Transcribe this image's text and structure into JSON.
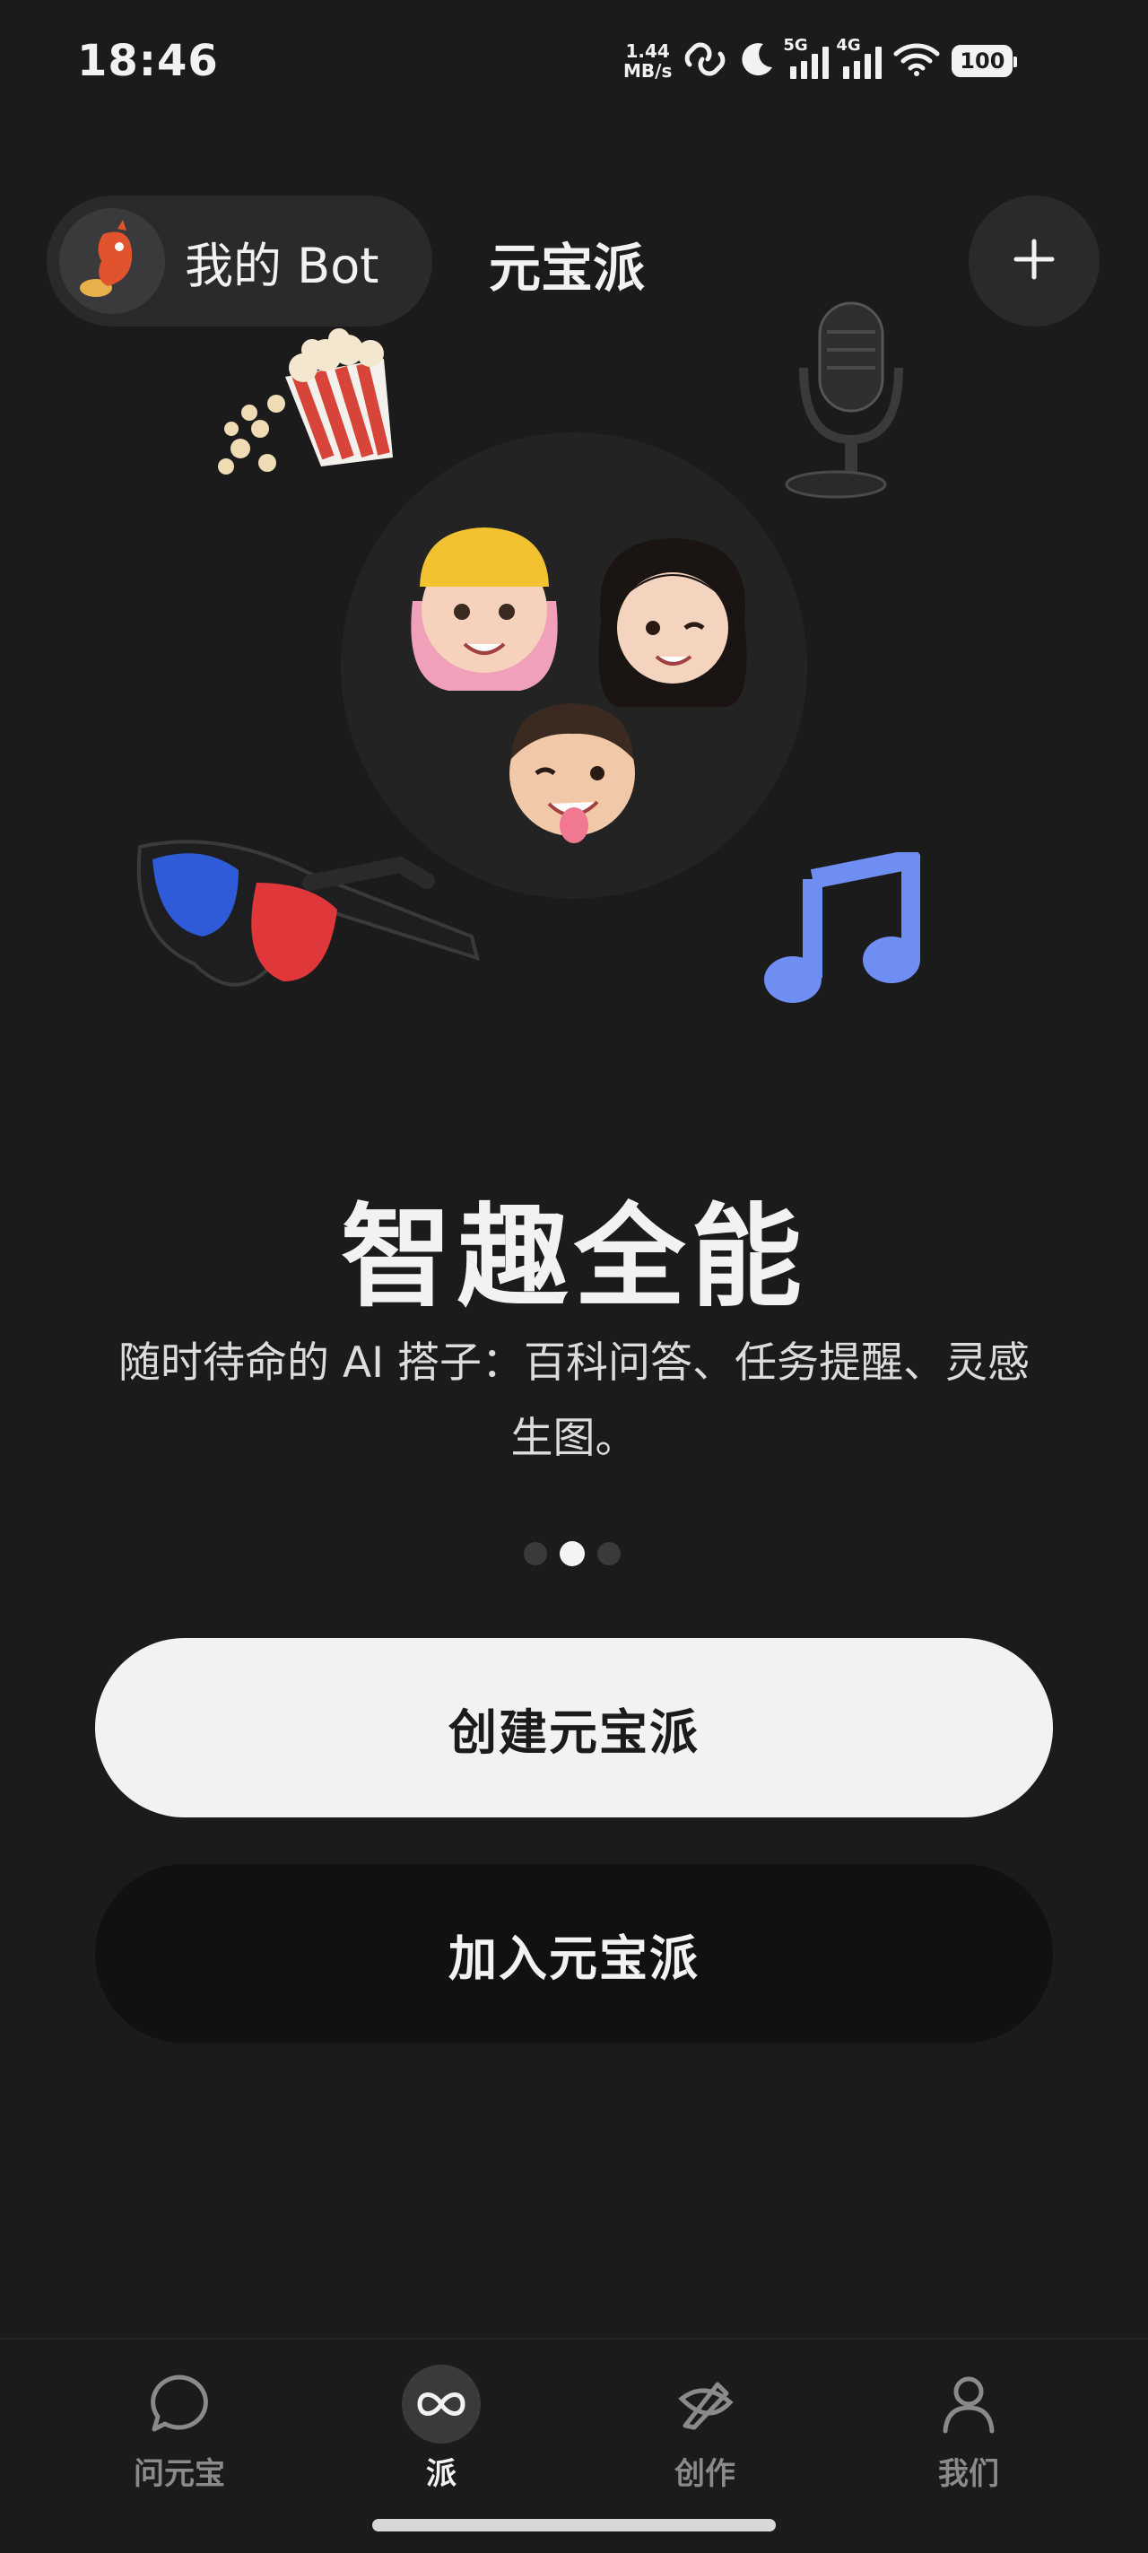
{
  "status_bar": {
    "time": "18:46",
    "net_speed_value": "1.44",
    "net_speed_unit": "MB/s",
    "signal1_label": "5G",
    "signal2_label": "4G",
    "battery": "100"
  },
  "top_nav": {
    "my_bot_label": "我的 Bot",
    "tab_label": "元宝派",
    "add_icon": "plus-icon"
  },
  "hero": {
    "title": "智趣全能",
    "description": "随时待命的 AI 搭子：百科问答、任务提醒、灵感生图。",
    "page_indicator": {
      "count": 3,
      "active_index": 1
    }
  },
  "actions": {
    "create_label": "创建元宝派",
    "join_label": "加入元宝派"
  },
  "bottom_nav": {
    "items": [
      {
        "label": "问元宝",
        "icon": "chat-bubble-icon",
        "active": false
      },
      {
        "label": "派",
        "icon": "infinity-icon",
        "active": true
      },
      {
        "label": "创作",
        "icon": "sparkle-pen-icon",
        "active": false
      },
      {
        "label": "我们",
        "icon": "person-icon",
        "active": false
      }
    ]
  },
  "colors": {
    "background": "#1b1b1c",
    "primary_button": "#f2f2f2",
    "secondary_button": "#111112",
    "inactive_nav": "#8a8a8c"
  }
}
